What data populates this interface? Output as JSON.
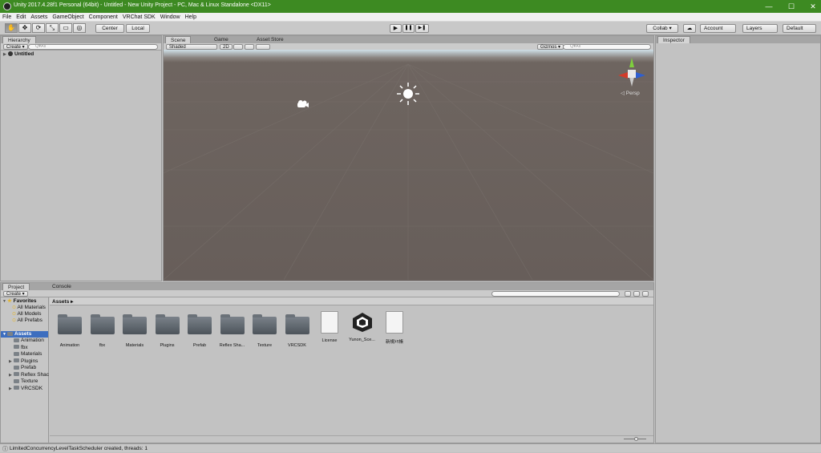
{
  "window": {
    "title": "Unity 2017.4.28f1 Personal (64bit) - Untitled - New Unity Project - PC, Mac & Linux Standalone <DX11>",
    "minimize": "—",
    "maximize": "☐",
    "close": "✕",
    "accent": "#3d8a22"
  },
  "menu": [
    "File",
    "Edit",
    "Assets",
    "GameObject",
    "Component",
    "VRChat SDK",
    "Window",
    "Help"
  ],
  "toolbar": {
    "tools": [
      "hand-tool",
      "move-tool",
      "rotate-tool",
      "scale-tool",
      "rect-tool",
      "transform-tool"
    ],
    "tool_glyphs": [
      "✋",
      "✥",
      "⟳",
      "⤡",
      "▭",
      "◎"
    ],
    "center": "Center",
    "local": "Local",
    "play": "▶",
    "pause": "❚❚",
    "step": "▶❚",
    "collab": "Collab ▾",
    "cloud": "☁",
    "account": "Account",
    "layers": "Layers",
    "layout": "Default"
  },
  "hierarchy": {
    "tab": "Hierarchy",
    "create": "Create ▾",
    "search_placeholder": "Q▾All",
    "scene_name": "Untitled"
  },
  "scene": {
    "tabs": [
      "Scene",
      "Game",
      "Asset Store"
    ],
    "shading": "Shaded",
    "mode_2d": "2D",
    "gizmos": "Gizmos ▾",
    "search_placeholder": "Q▾All",
    "persp_label": "◁ Persp"
  },
  "inspector": {
    "tab": "Inspector"
  },
  "project": {
    "tabs": [
      "Project",
      "Console"
    ],
    "create": "Create ▾",
    "favorites": {
      "label": "Favorites",
      "items": [
        "All Materials",
        "All Models",
        "All Prefabs"
      ]
    },
    "assets_root": "Assets",
    "tree": [
      "Animation",
      "fbx",
      "Materials",
      "Plugins",
      "Prefab",
      "Reflex Shac",
      "Texture",
      "VRCSDK"
    ],
    "tree_has_children": [
      false,
      false,
      false,
      true,
      false,
      true,
      false,
      true
    ],
    "breadcrumb": "Assets ▸",
    "grid": [
      {
        "label": "Animation",
        "kind": "folder"
      },
      {
        "label": "fbx",
        "kind": "folder"
      },
      {
        "label": "Materials",
        "kind": "folder"
      },
      {
        "label": "Plugins",
        "kind": "folder"
      },
      {
        "label": "Prefab",
        "kind": "folder"
      },
      {
        "label": "Reflex Sha...",
        "kind": "folder"
      },
      {
        "label": "Texture",
        "kind": "folder"
      },
      {
        "label": "VRCSDK",
        "kind": "folder"
      },
      {
        "label": "License",
        "kind": "doc"
      },
      {
        "label": "Yunon_Sce...",
        "kind": "unity"
      },
      {
        "label": "新規ﾒﾓ帳",
        "kind": "doc"
      }
    ]
  },
  "status": {
    "message": "LimitedConcurrencyLevelTaskScheduler created, threads: 1"
  }
}
